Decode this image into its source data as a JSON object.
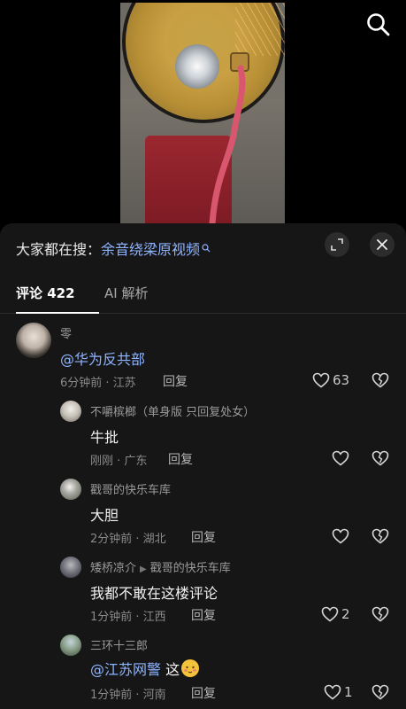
{
  "video": {
    "description_icon": "angle-grinder-video"
  },
  "top": {
    "search_icon": "search-icon"
  },
  "panel": {
    "trending_label": "大家都在搜：",
    "trending_query": "余音绕梁原视频",
    "tabs": [
      {
        "label": "评论 422"
      },
      {
        "label": "AI 解析"
      }
    ]
  },
  "comments": [
    {
      "author": "零",
      "text_mention": "@华为反共部",
      "time_location": "6分钟前 · 江苏",
      "reply": "回复",
      "likes": "63"
    },
    {
      "author": "不嚼槟榔（单身版 只回复处女）",
      "text": "牛批",
      "time_location": "刚刚 · 广东",
      "reply": "回复",
      "likes": ""
    },
    {
      "author": "戳哥的快乐车库",
      "text": "大胆",
      "time_location": "2分钟前 · 湖北",
      "reply": "回复",
      "likes": ""
    },
    {
      "author": "矮桥凉介",
      "reply_to": "戳哥的快乐车库",
      "text": "我都不敢在这楼评论",
      "time_location": "1分钟前 · 江西",
      "reply": "回复",
      "likes": "2"
    },
    {
      "author": "三环十三郎",
      "text_mention": "@江苏网警",
      "text": "这",
      "time_location": "1分钟前 · 河南",
      "reply": "回复",
      "likes": "1"
    }
  ],
  "colors": {
    "panel_bg": "#161616",
    "link": "#8fb4ff"
  }
}
